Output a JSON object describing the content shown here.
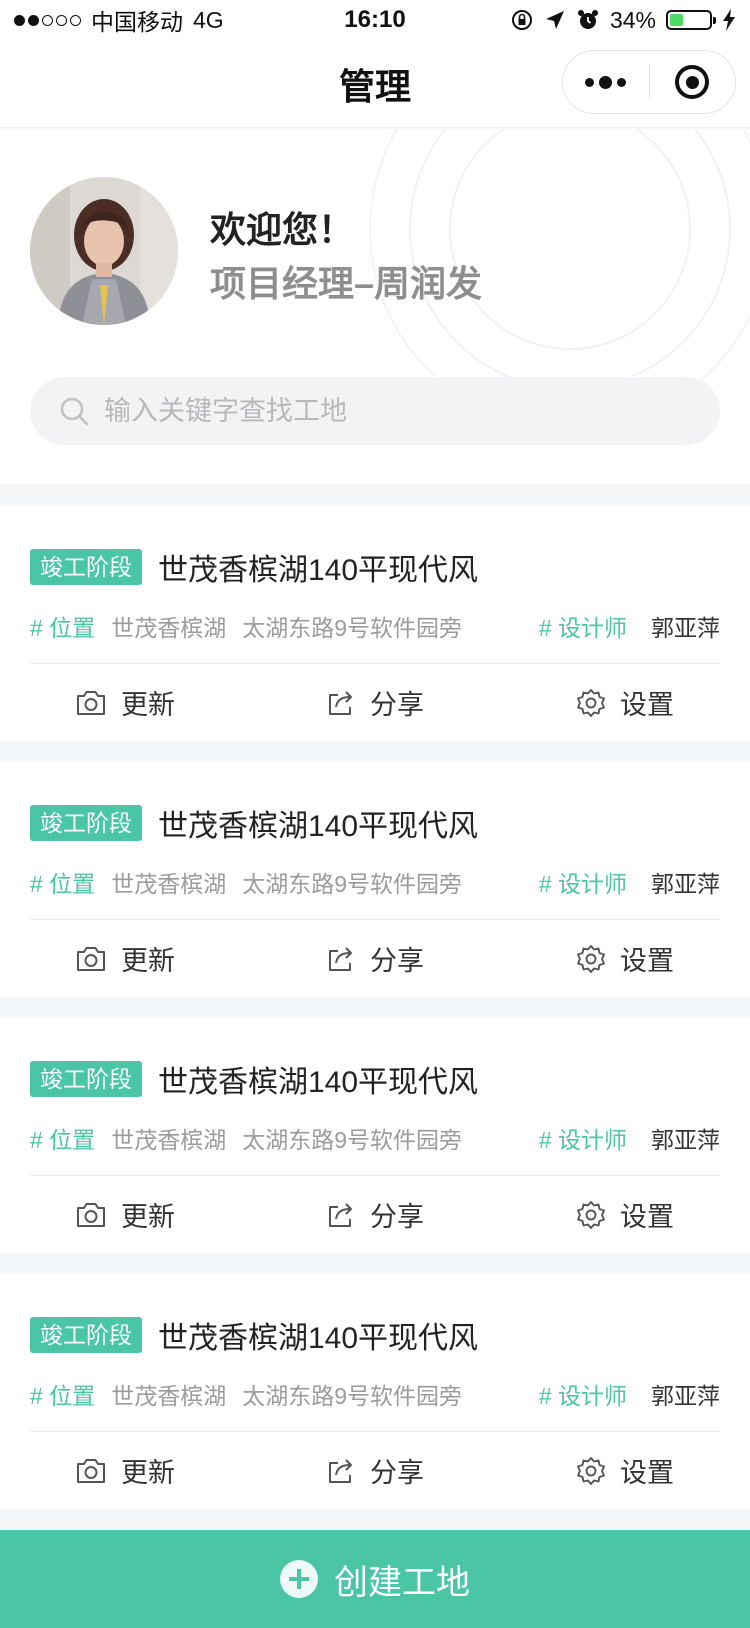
{
  "status_bar": {
    "carrier": "中国移动",
    "network": "4G",
    "time": "16:10",
    "battery": "34%",
    "battery_level": 0.34,
    "signal_bars_filled": 2,
    "signal_bars_total": 5
  },
  "nav": {
    "title": "管理"
  },
  "profile": {
    "welcome": "欢迎您！",
    "role": "项目经理–周润发"
  },
  "search": {
    "placeholder": "输入关键字查找工地"
  },
  "sites": [
    {
      "badge": "竣工阶段",
      "title": "世茂香槟湖140平现代风",
      "location_tag": "# 位置",
      "location_name": "世茂香槟湖",
      "address": "太湖东路9号软件园旁",
      "designer_tag": "# 设计师",
      "designer": "郭亚萍",
      "actions": {
        "update": "更新",
        "share": "分享",
        "settings": "设置"
      }
    },
    {
      "badge": "竣工阶段",
      "title": "世茂香槟湖140平现代风",
      "location_tag": "# 位置",
      "location_name": "世茂香槟湖",
      "address": "太湖东路9号软件园旁",
      "designer_tag": "# 设计师",
      "designer": "郭亚萍",
      "actions": {
        "update": "更新",
        "share": "分享",
        "settings": "设置"
      }
    },
    {
      "badge": "竣工阶段",
      "title": "世茂香槟湖140平现代风",
      "location_tag": "# 位置",
      "location_name": "世茂香槟湖",
      "address": "太湖东路9号软件园旁",
      "designer_tag": "# 设计师",
      "designer": "郭亚萍",
      "actions": {
        "update": "更新",
        "share": "分享",
        "settings": "设置"
      }
    },
    {
      "badge": "竣工阶段",
      "title": "世茂香槟湖140平现代风",
      "location_tag": "# 位置",
      "location_name": "世茂香槟湖",
      "address": "太湖东路9号软件园旁",
      "designer_tag": "# 设计师",
      "designer": "郭亚萍",
      "actions": {
        "update": "更新",
        "share": "分享",
        "settings": "设置"
      }
    }
  ],
  "create_button": {
    "label": "创建工地"
  },
  "colors": {
    "accent": "#4ac5a6",
    "text": "#333333",
    "muted": "#9b9b9b",
    "background": "#f5f6f7"
  }
}
